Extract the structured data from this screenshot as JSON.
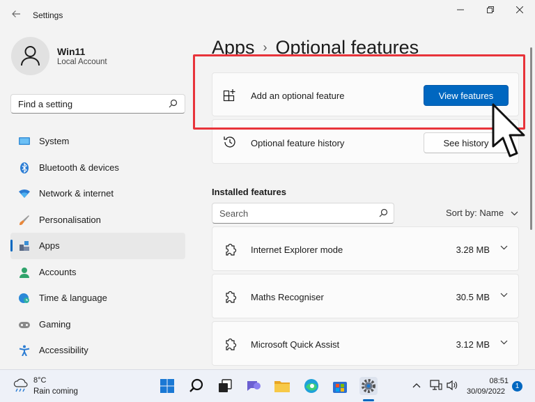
{
  "window": {
    "title": "Settings",
    "back_icon": "arrow-left-icon"
  },
  "profile": {
    "name": "Win11",
    "subtitle": "Local Account"
  },
  "search": {
    "placeholder": "Find a setting"
  },
  "sidebar": {
    "items": [
      {
        "label": "System",
        "icon": "monitor-icon"
      },
      {
        "label": "Bluetooth & devices",
        "icon": "bluetooth-icon"
      },
      {
        "label": "Network & internet",
        "icon": "wifi-icon"
      },
      {
        "label": "Personalisation",
        "icon": "brush-icon"
      },
      {
        "label": "Apps",
        "icon": "apps-icon",
        "active": true
      },
      {
        "label": "Accounts",
        "icon": "person-icon"
      },
      {
        "label": "Time & language",
        "icon": "globe-clock-icon"
      },
      {
        "label": "Gaming",
        "icon": "gamepad-icon"
      },
      {
        "label": "Accessibility",
        "icon": "accessibility-icon"
      }
    ]
  },
  "header": {
    "crumb": "Apps",
    "separator": "›",
    "title": "Optional features"
  },
  "add_feature": {
    "label": "Add an optional feature",
    "button": "View features"
  },
  "history": {
    "label": "Optional feature history",
    "button": "See history"
  },
  "installed": {
    "title": "Installed features",
    "search_placeholder": "Search",
    "sort_label": "Sort by: Name",
    "features": [
      {
        "name": "Internet Explorer mode",
        "size": "3.28 MB"
      },
      {
        "name": "Maths Recogniser",
        "size": "30.5 MB"
      },
      {
        "name": "Microsoft Quick Assist",
        "size": "3.12 MB"
      }
    ]
  },
  "taskbar": {
    "weather": {
      "temp": "8°C",
      "desc": "Rain coming"
    },
    "time": "08:51",
    "date": "30/09/2022",
    "notifications": "1"
  },
  "colors": {
    "accent": "#0067c0",
    "highlight": "#e8333a"
  }
}
